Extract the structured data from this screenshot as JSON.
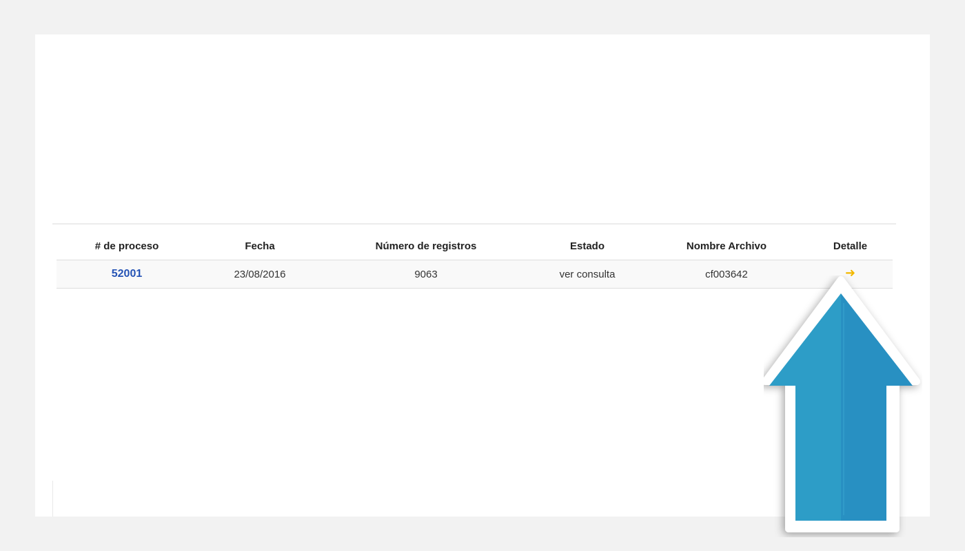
{
  "table": {
    "headers": {
      "process": "# de proceso",
      "date": "Fecha",
      "records": "Número de registros",
      "status": "Estado",
      "filename": "Nombre Archivo",
      "detail": "Detalle"
    },
    "rows": [
      {
        "process": "52001",
        "date": "23/08/2016",
        "records": "9063",
        "status": "ver consulta",
        "filename": "cf003642",
        "detail_icon": "arrow-right-icon"
      }
    ]
  },
  "overlay": {
    "icon": "up-arrow-icon",
    "color_light": "#2d9dc7",
    "color_dark": "#2890c2"
  },
  "colors": {
    "link": "#2553b5",
    "detail_arrow": "#f2b800"
  }
}
